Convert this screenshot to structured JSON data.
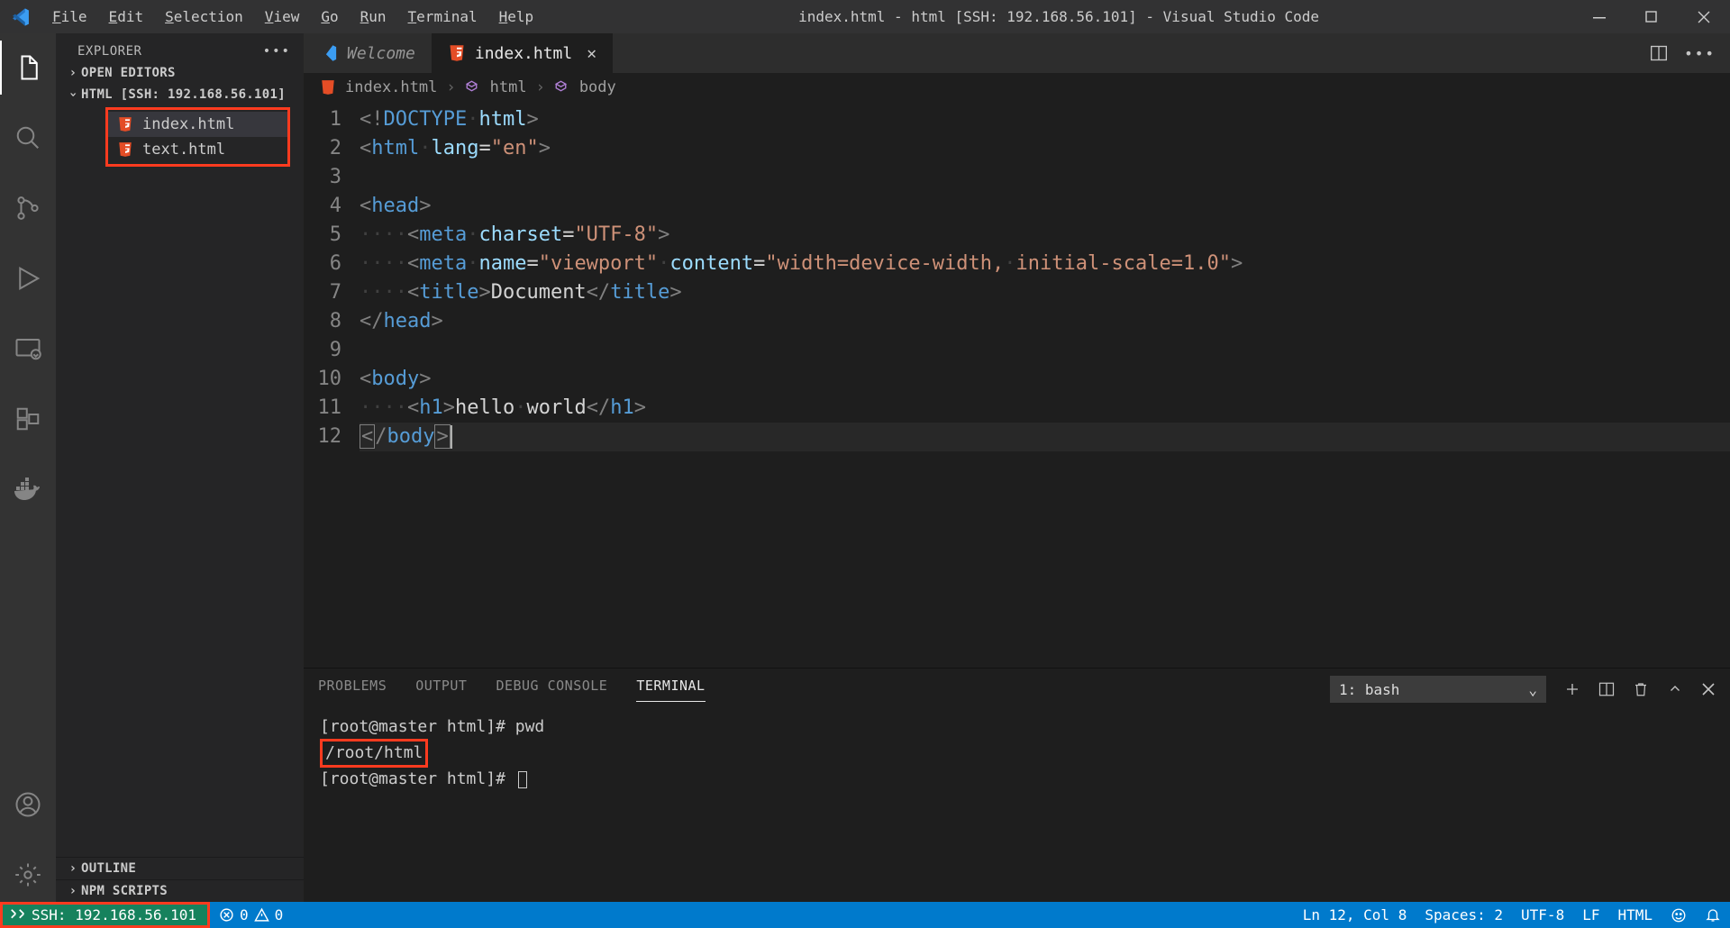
{
  "title_bar": {
    "menu": [
      "File",
      "Edit",
      "Selection",
      "View",
      "Go",
      "Run",
      "Terminal",
      "Help"
    ],
    "title": "index.html - html [SSH: 192.168.56.101] - Visual Studio Code"
  },
  "activity": {
    "items": [
      "files",
      "search",
      "scm",
      "debug",
      "remote",
      "extensions",
      "docker"
    ],
    "bottom": [
      "account",
      "settings"
    ]
  },
  "sidebar": {
    "title": "EXPLORER",
    "sections": {
      "open_editors": "OPEN EDITORS",
      "workspace": "HTML [SSH: 192.168.56.101]",
      "outline": "OUTLINE",
      "npm": "NPM SCRIPTS"
    },
    "files": [
      {
        "name": "index.html",
        "active": true
      },
      {
        "name": "text.html",
        "active": false
      }
    ]
  },
  "tabs": [
    {
      "label": "Welcome",
      "kind": "vs",
      "active": false,
      "italic": true
    },
    {
      "label": "index.html",
      "kind": "html",
      "active": true,
      "italic": false
    }
  ],
  "breadcrumb": [
    "index.html",
    "html",
    "body"
  ],
  "code": {
    "lines": [
      {
        "n": 1,
        "html": "<span class='t-gray'>&lt;!</span><span class='t-blue'>DOCTYPE</span><span class='indent'>·</span><span class='t-lblue'>html</span><span class='t-gray'>&gt;</span>"
      },
      {
        "n": 2,
        "html": "<span class='t-gray'>&lt;</span><span class='t-blue'>html</span><span class='indent'>·</span><span class='t-lblue'>lang</span><span class='t-white'>=</span><span class='t-orange'>\"en\"</span><span class='t-gray'>&gt;</span>"
      },
      {
        "n": 3,
        "html": ""
      },
      {
        "n": 4,
        "html": "<span class='t-gray'>&lt;</span><span class='t-blue'>head</span><span class='t-gray'>&gt;</span>"
      },
      {
        "n": 5,
        "html": "<span class='indent'>····</span><span class='t-gray'>&lt;</span><span class='t-blue'>meta</span><span class='indent'>·</span><span class='t-lblue'>charset</span><span class='t-white'>=</span><span class='t-orange'>\"UTF-8\"</span><span class='t-gray'>&gt;</span>"
      },
      {
        "n": 6,
        "html": "<span class='indent'>····</span><span class='t-gray'>&lt;</span><span class='t-blue'>meta</span><span class='indent'>·</span><span class='t-lblue'>name</span><span class='t-white'>=</span><span class='t-orange'>\"viewport\"</span><span class='indent'>·</span><span class='t-lblue'>content</span><span class='t-white'>=</span><span class='t-orange'>\"width=device-width,<span class='indent'>·</span>initial-scale=1.0\"</span><span class='t-gray'>&gt;</span>"
      },
      {
        "n": 7,
        "html": "<span class='indent'>····</span><span class='t-gray'>&lt;</span><span class='t-blue'>title</span><span class='t-gray'>&gt;</span><span class='t-white'>Document</span><span class='t-gray'>&lt;/</span><span class='t-blue'>title</span><span class='t-gray'>&gt;</span>"
      },
      {
        "n": 8,
        "html": "<span class='t-gray'>&lt;/</span><span class='t-blue'>head</span><span class='t-gray'>&gt;</span>"
      },
      {
        "n": 9,
        "html": ""
      },
      {
        "n": 10,
        "html": "<span class='t-gray'>&lt;</span><span class='t-blue'>body</span><span class='t-gray'>&gt;</span>"
      },
      {
        "n": 11,
        "html": "<span class='indent'>····</span><span class='t-gray'>&lt;</span><span class='t-blue'>h1</span><span class='t-gray'>&gt;</span><span class='t-white'>hello<span class='indent'>·</span>world</span><span class='t-gray'>&lt;/</span><span class='t-blue'>h1</span><span class='t-gray'>&gt;</span>"
      },
      {
        "n": 12,
        "html": "<span class='curbox'><span class='t-gray'>&lt;</span></span><span class='t-gray'>/</span><span class='t-blue'>body</span><span class='curbox'><span class='t-gray'>&gt;</span></span><span class='cursor'></span>",
        "cur": true
      }
    ]
  },
  "panel": {
    "tabs": [
      "PROBLEMS",
      "OUTPUT",
      "DEBUG CONSOLE",
      "TERMINAL"
    ],
    "active": "TERMINAL",
    "selector": "1: bash",
    "lines": [
      {
        "text": "[root@master html]# pwd",
        "hl": false
      },
      {
        "text": "/root/html",
        "hl": true
      },
      {
        "text": "[root@master html]# ",
        "hl": false,
        "cursor": true
      }
    ]
  },
  "status": {
    "remote": "SSH: 192.168.56.101",
    "errors": "0",
    "warnings": "0",
    "ln": "Ln 12, Col 8",
    "spaces": "Spaces: 2",
    "encoding": "UTF-8",
    "eol": "LF",
    "lang": "HTML"
  }
}
